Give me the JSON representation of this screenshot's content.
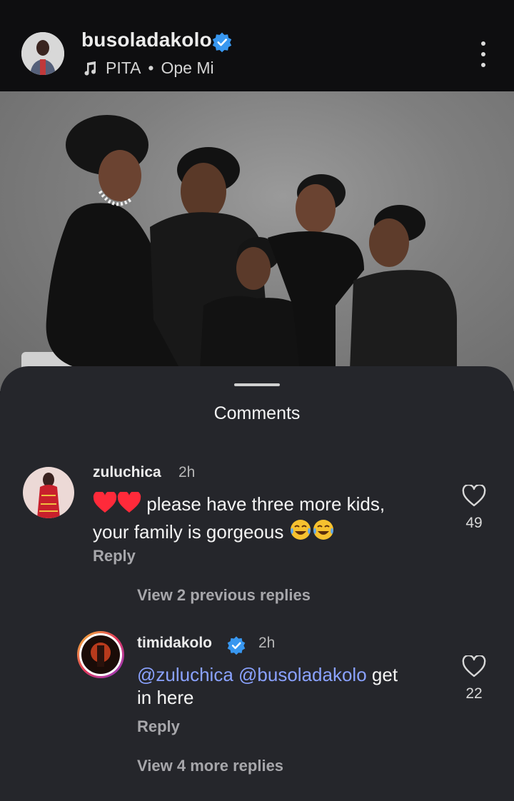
{
  "post": {
    "username": "busoladakolo",
    "music_artist": "PITA",
    "music_separator": "•",
    "music_title": "Ope Mi"
  },
  "comments_sheet": {
    "title": "Comments",
    "comments": [
      {
        "username": "zuluchica",
        "time": "2h",
        "text": "please have three more kids, your family is gorgeous",
        "text_line1": "please have three more kids,",
        "text_line2": "your family is gorgeous",
        "emoji_before": [
          "red-heart",
          "red-heart"
        ],
        "emoji_after": [
          "tears-of-joy",
          "tears-of-joy"
        ],
        "likes": "49",
        "reply_label": "Reply",
        "view_replies_label": "View 2 previous replies"
      },
      {
        "username": "timidakolo",
        "verified": true,
        "time": "2h",
        "mention1": "@zuluchica",
        "mention2": "@busoladakolo",
        "text_rest_line1": "get",
        "text_line2": "in here",
        "likes": "22",
        "reply_label": "Reply",
        "view_replies_label": "View 4 more replies"
      }
    ]
  },
  "colors": {
    "header_bg": "#0e0e10",
    "sheet_bg": "#25262b",
    "mention": "#8aa2ff",
    "verified": "#3897f0",
    "heart": "#ff2a3a"
  }
}
